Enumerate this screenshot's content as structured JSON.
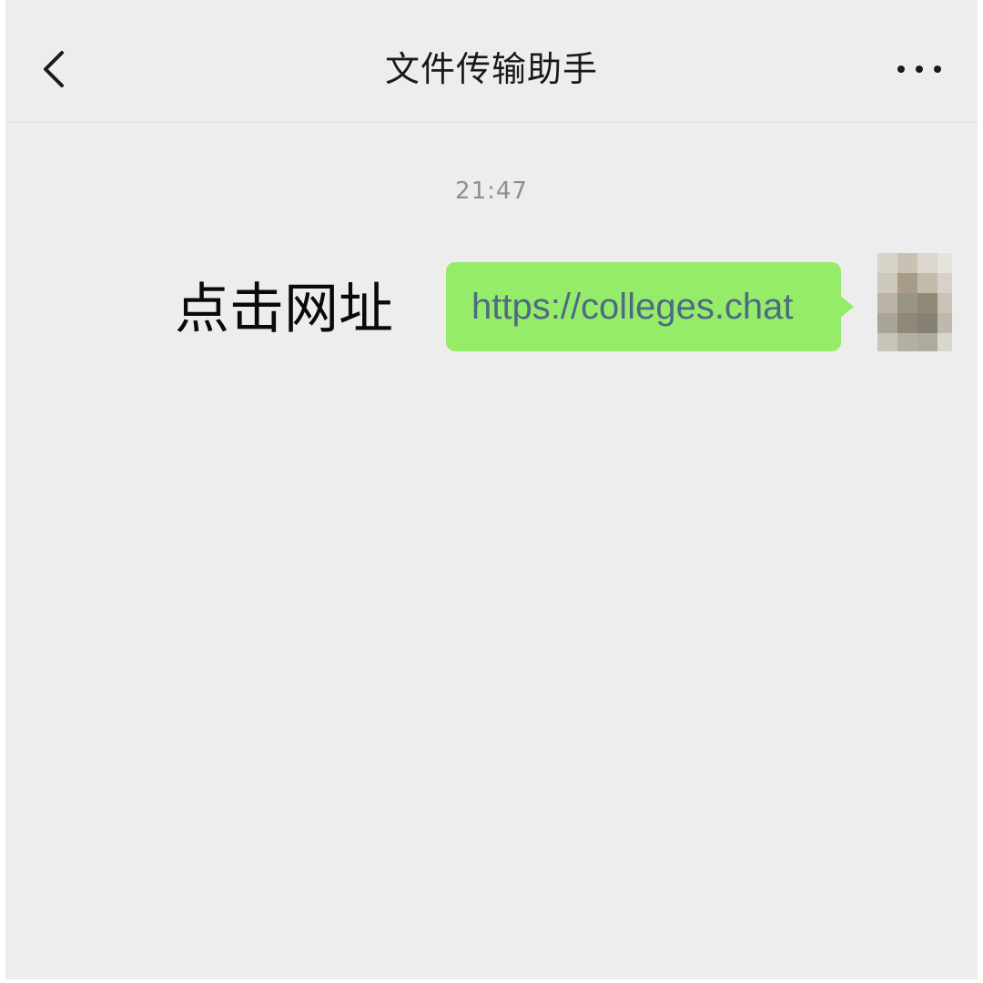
{
  "header": {
    "title": "文件传输助手",
    "back_icon": "chevron-left-icon",
    "more_icon": "more-dots-icon"
  },
  "chat": {
    "timestamp": "21:47",
    "messages": [
      {
        "sender": "self",
        "type": "link",
        "text": "https://colleges.chat",
        "bubble_color": "#95ec69",
        "text_color": "#4e6a84"
      }
    ]
  },
  "overlay": {
    "annotation": "点击网址"
  },
  "colors": {
    "background": "#ededed",
    "bubble": "#95ec69",
    "link_text": "#4e6a84",
    "timestamp": "#8f8f8f"
  }
}
